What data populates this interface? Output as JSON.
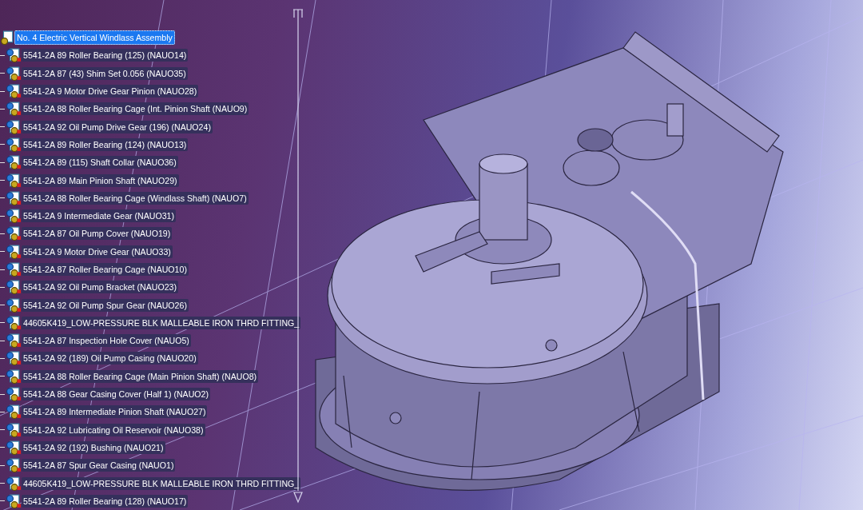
{
  "tree": {
    "label": "No. 4 Electric Vertical Windlass Assembly",
    "selected": true,
    "children": [
      {
        "label": "5541-2A 89 Roller Bearing (125) (NAUO14)",
        "selected": false
      },
      {
        "label": "5541-2A 87 (43) Shim Set 0.056 (NAUO35)",
        "selected": false
      },
      {
        "label": "5541-2A 9 Motor Drive Gear Pinion (NAUO28)",
        "selected": false
      },
      {
        "label": "5541-2A 88 Roller Bearing Cage (Int. Pinion Shaft (NAUO9)",
        "selected": false
      },
      {
        "label": "5541-2A 92 Oil Pump Drive Gear (196) (NAUO24)",
        "selected": false
      },
      {
        "label": "5541-2A 89 Roller Bearing (124) (NAUO13)",
        "selected": false
      },
      {
        "label": "5541-2A 89 (115) Shaft Collar (NAUO36)",
        "selected": false
      },
      {
        "label": "5541-2A 89 Main Pinion Shaft (NAUO29)",
        "selected": false
      },
      {
        "label": "5541-2A 88 Roller Bearing Cage (Windlass Shaft) (NAUO7)",
        "selected": false
      },
      {
        "label": "5541-2A 9 Intermediate Gear (NAUO31)",
        "selected": false
      },
      {
        "label": "5541-2A 87 Oil Pump Cover (NAUO19)",
        "selected": false
      },
      {
        "label": "5541-2A 9 Motor Drive Gear (NAUO33)",
        "selected": false
      },
      {
        "label": "5541-2A 87 Roller Bearing Cage (NAUO10)",
        "selected": false
      },
      {
        "label": "5541-2A 92 Oil Pump Bracket (NAUO23)",
        "selected": false
      },
      {
        "label": "5541-2A 92 Oil Pump Spur Gear (NAUO26)",
        "selected": false
      },
      {
        "label": "44605K419_LOW-PRESSURE BLK MALLEABLE IRON THRD FITTING_",
        "selected": false
      },
      {
        "label": "5541-2A 87 Inspection Hole Cover (NAUO5)",
        "selected": false
      },
      {
        "label": "5541-2A 92 (189) Oil Pump Casing (NAUO20)",
        "selected": false
      },
      {
        "label": "5541-2A 88 Roller Bearing Cage (Main Pinion Shaft) (NAUO8)",
        "selected": false
      },
      {
        "label": "5541-2A 88 Gear Casing Cover (Half 1) (NAUO2)",
        "selected": false
      },
      {
        "label": "5541-2A 89 Intermediate Pinion Shaft (NAUO27)",
        "selected": false
      },
      {
        "label": "5541-2A 92 Lubricating Oil Reservoir (NAUO38)",
        "selected": false
      },
      {
        "label": "5541-2A 92 (192) Bushing (NAUO21)",
        "selected": false
      },
      {
        "label": "5541-2A 87 Spur Gear Casing (NAUO1)",
        "selected": false
      },
      {
        "label": "44605K419_LOW-PRESSURE BLK MALLEABLE IRON THRD FITTING_",
        "selected": false
      },
      {
        "label": "5541-2A 89 Roller Bearing (128) (NAUO17)",
        "selected": false
      }
    ]
  }
}
